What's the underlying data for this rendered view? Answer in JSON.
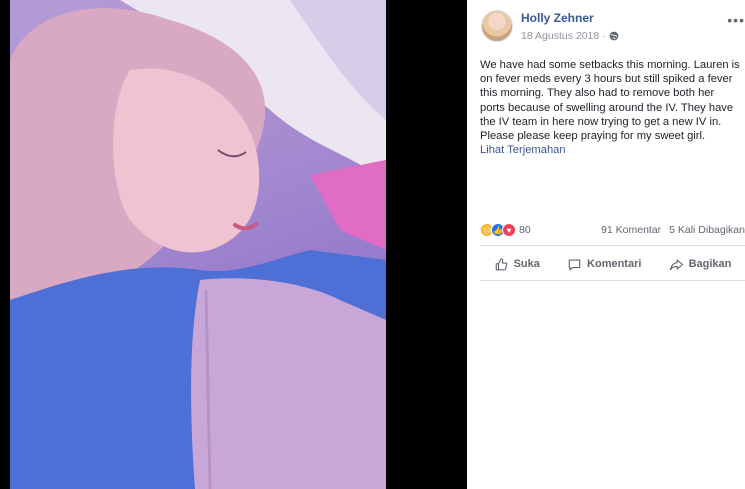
{
  "post": {
    "author": "Holly Zehner",
    "date": "18 Agustus 2018 ·",
    "text": "We have had some setbacks this morning. Lauren is on fever meds every 3 hours but still spiked a fever this morning. They also had to remove both her ports because of swelling around the IV. They have the IV team in here now trying to get a new IV in. Please please keep praying for my sweet girl.",
    "translate_link": "Lihat Terjemahan",
    "reaction_count": "80",
    "comments": "91 Komentar",
    "shares": "5 Kali Dibagikan",
    "actions": {
      "like": "Suka",
      "comment": "Komentari",
      "share": "Bagikan"
    }
  },
  "icons": {
    "globe": "globe-icon",
    "more": "more-options-icon",
    "like": "thumbs-up-icon",
    "comment": "comment-bubble-icon",
    "share": "share-arrow-icon"
  },
  "colors": {
    "link": "#385898",
    "text": "#1d2129",
    "muted": "#606770",
    "reaction_sad": "#f7b125",
    "reaction_like": "#1877f2",
    "reaction_love": "#f33e58"
  }
}
